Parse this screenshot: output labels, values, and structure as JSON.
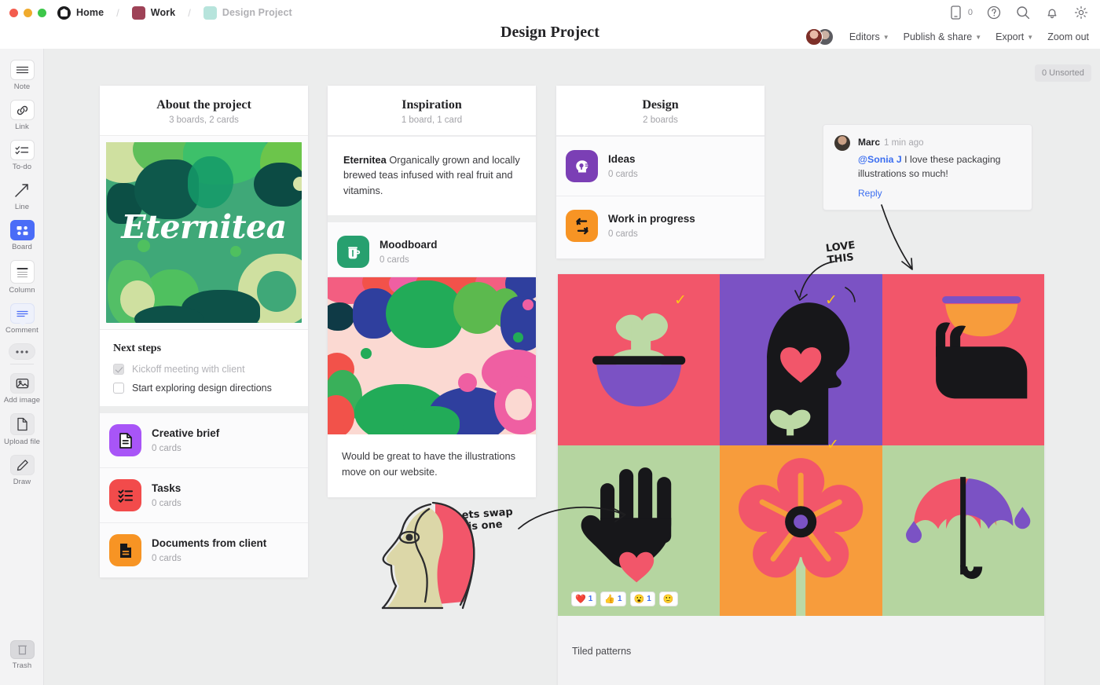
{
  "window": {
    "breadcrumb": [
      {
        "label": "Home",
        "icon": "home-icon"
      },
      {
        "label": "Work",
        "icon": "folder-swatch"
      },
      {
        "label": "Design Project",
        "icon": "board-swatch"
      }
    ],
    "separator": "/"
  },
  "header": {
    "title": "Design Project",
    "actions": [
      {
        "label": "Editors",
        "caret": true
      },
      {
        "label": "Publish & share",
        "caret": true
      },
      {
        "label": "Export",
        "caret": true
      },
      {
        "label": "Zoom out",
        "caret": false
      }
    ],
    "icons": [
      "mobile-icon",
      "help-icon",
      "search-icon",
      "bell-icon",
      "gear-icon"
    ],
    "mobile_count": "0"
  },
  "toolbar": {
    "items": [
      {
        "label": "Note",
        "icon": "note-icon",
        "active": false
      },
      {
        "label": "Link",
        "icon": "link-icon",
        "active": false
      },
      {
        "label": "To-do",
        "icon": "todo-icon",
        "active": false
      },
      {
        "label": "Line",
        "icon": "line-icon",
        "active": false
      },
      {
        "label": "Board",
        "icon": "board-icon",
        "active": true
      },
      {
        "label": "Column",
        "icon": "column-icon",
        "active": false
      },
      {
        "label": "Comment",
        "icon": "comment-icon",
        "active": false
      },
      {
        "label": "",
        "icon": "more-icon",
        "active": false
      }
    ],
    "items2": [
      {
        "label": "Add image",
        "icon": "image-icon"
      },
      {
        "label": "Upload file",
        "icon": "file-icon"
      },
      {
        "label": "Draw",
        "icon": "pencil-icon"
      }
    ],
    "trash": {
      "label": "Trash",
      "icon": "trash-icon"
    }
  },
  "canvas": {
    "unsorted_badge": "0 Unsorted"
  },
  "columns": [
    {
      "title": "About the project",
      "subtitle": "3 boards, 2 cards",
      "next_steps": {
        "title": "Next steps",
        "todos": [
          {
            "text": "Kickoff meeting with client",
            "done": true
          },
          {
            "text": "Start exploring design directions",
            "done": false
          }
        ]
      },
      "boards": [
        {
          "name": "Creative brief",
          "cards": "0 cards",
          "color": "#a855f7",
          "icon": "document-icon"
        },
        {
          "name": "Tasks",
          "cards": "0 cards",
          "color": "#f24b4b",
          "icon": "checklist-icon"
        },
        {
          "name": "Documents from client",
          "cards": "0 cards",
          "color": "#f79424",
          "icon": "document-icon"
        }
      ]
    },
    {
      "title": "Inspiration",
      "subtitle": "1 board, 1 card",
      "note": {
        "bold": "Eternitea",
        "text": " Organically grown and locally brewed teas infused with real fruit and vitamins."
      },
      "boards": [
        {
          "name": "Moodboard",
          "cards": "0 cards",
          "color": "#27a06f",
          "icon": "teapot-icon"
        }
      ],
      "image_caption": "Would be great to have the illustrations move on our website."
    },
    {
      "title": "Design",
      "subtitle": "2 boards",
      "boards": [
        {
          "name": "Ideas",
          "cards": "0 cards",
          "color": "#7b3fb5",
          "icon": "head-idea-icon"
        },
        {
          "name": "Work in progress",
          "cards": "0 cards",
          "color": "#f79424",
          "icon": "repeat-icon"
        }
      ]
    }
  ],
  "comment": {
    "author": "Marc",
    "time": "1 min ago",
    "mention": "@Sonia J",
    "body": " I love these packaging illustrations so much!",
    "reply_label": "Reply"
  },
  "tiles": {
    "caption": "Tiled patterns",
    "reactions": [
      {
        "emoji": "❤️",
        "count": "1"
      },
      {
        "emoji": "👍",
        "count": "1"
      },
      {
        "emoji": "😮",
        "count": "1"
      },
      {
        "emoji": "🙂",
        "count": ""
      }
    ],
    "cells": [
      {
        "name": "plant-in-bowl",
        "bg": "#f2566a"
      },
      {
        "name": "head-with-heart",
        "bg": "#7b52c4"
      },
      {
        "name": "hand-holding-cup",
        "bg": "#f2566a"
      },
      {
        "name": "hand-with-heart",
        "bg": "#b5d5a0"
      },
      {
        "name": "flower",
        "bg": "#f79c3c"
      },
      {
        "name": "umbrella-rain",
        "bg": "#b5d5a0"
      }
    ],
    "checks": 3
  },
  "annotations": [
    {
      "text": "LOVE\nTHIS",
      "name": "love-this-note"
    },
    {
      "text": "Lets swap\nthis one",
      "name": "swap-this-note"
    }
  ],
  "brand_colors": {
    "accent_blue": "#3b6ef0",
    "tool_active": "#4a6cf7",
    "pink": "#f2566a",
    "purple": "#7b52c4",
    "orange": "#f79c3c",
    "green": "#b5d5a0",
    "yellow_check": "#fcc419"
  }
}
